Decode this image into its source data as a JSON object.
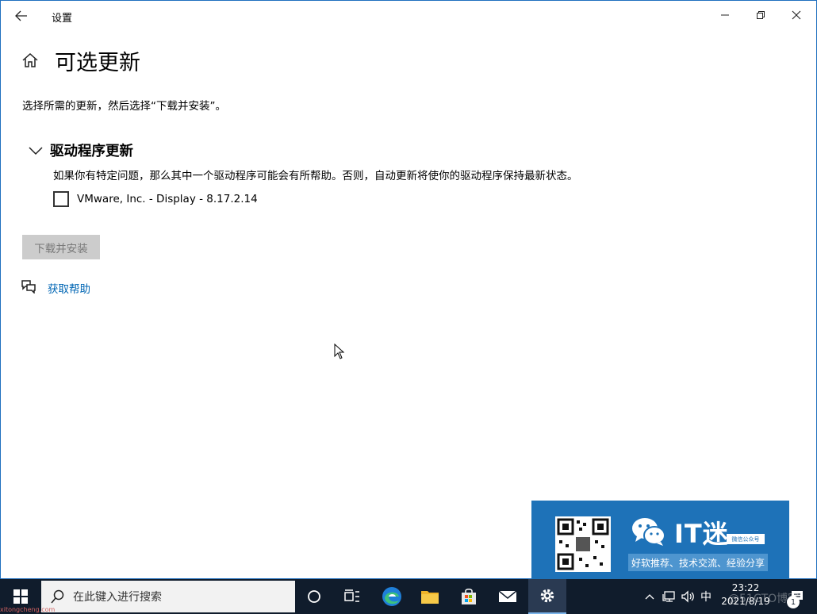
{
  "window": {
    "title": "设置",
    "back_icon": "arrow-left-icon",
    "minimize_icon": "minimize-icon",
    "restore_icon": "restore-icon",
    "close_icon": "close-icon"
  },
  "page": {
    "home_icon": "home-icon",
    "title": "可选更新",
    "instruction": "选择所需的更新，然后选择“下载并安装”。"
  },
  "section": {
    "title": "驱动程序更新",
    "expanded": true,
    "description": "如果你有特定问题，那么其中一个驱动程序可能会有所帮助。否则，自动更新将使你的驱动程序保持最新状态。",
    "items": [
      {
        "label": "VMware, Inc. - Display - 8.17.2.14",
        "checked": false
      }
    ]
  },
  "actions": {
    "install_label": "下载并安装",
    "install_enabled": false
  },
  "help": {
    "label": "获取帮助",
    "icon": "chat-help-icon"
  },
  "promo": {
    "brand": "IT迷",
    "badge": "微信公众号",
    "tagline": "好软推荐、技术交流、经验分享"
  },
  "taskbar": {
    "search_placeholder": "在此键入进行搜索",
    "ime": "中",
    "time": "23:22",
    "date": "2021/8/19",
    "notification_count": "1",
    "watermark_url": "xitongcheng.com",
    "watermark_corner": "@51CTO博客"
  },
  "colors": {
    "accent": "#0066b4",
    "taskbar": "#101c2c",
    "promo": "#1e72b8",
    "disabled_button": "#cccccc"
  }
}
